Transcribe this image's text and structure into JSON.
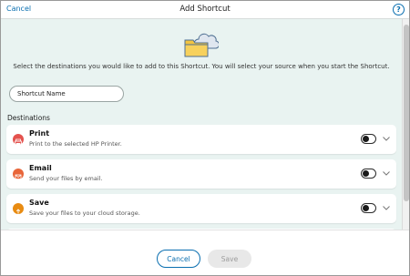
{
  "header": {
    "cancel_label": "Cancel",
    "title": "Add Shortcut",
    "help_glyph": "?"
  },
  "illustration": {
    "icon": "folder-cloud-icon"
  },
  "instructions": "Select the destinations you would like to add to this Shortcut. You will select your source when you start the Shortcut.",
  "shortcut_name": {
    "placeholder": "Shortcut Name",
    "value": ""
  },
  "destinations_label": "Destinations",
  "destinations": [
    {
      "title": "Print",
      "description": "Print to the selected HP Printer.",
      "icon": "printer-icon",
      "color": "#e4524e",
      "enabled": false
    },
    {
      "title": "Email",
      "description": "Send your files by email.",
      "icon": "email-icon",
      "color": "#e8663a",
      "enabled": false
    },
    {
      "title": "Save",
      "description": "Save your files to your cloud storage.",
      "icon": "cloud-upload-icon",
      "color": "#e88b12",
      "enabled": false
    }
  ],
  "footer": {
    "cancel_label": "Cancel",
    "save_label": "Save"
  },
  "colors": {
    "accent": "#0a6fb0",
    "background": "#e9f3f1",
    "disabled_bg": "#e8e8e8",
    "disabled_text": "#9c9c9c"
  }
}
